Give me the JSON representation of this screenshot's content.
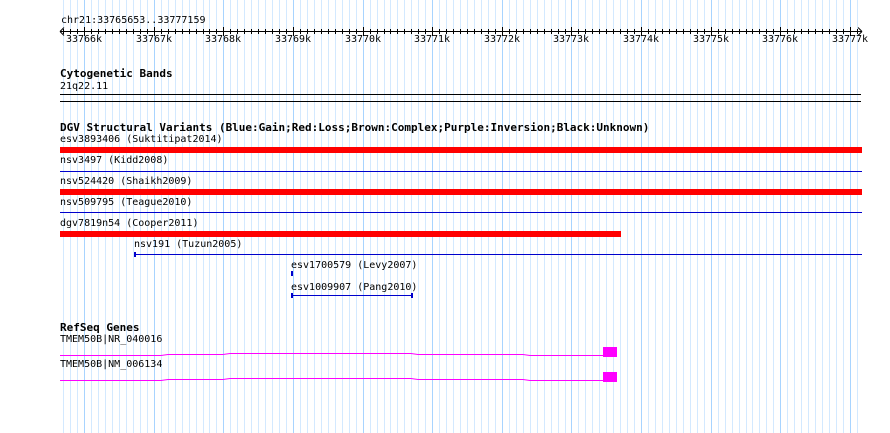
{
  "ruler": {
    "label": "chr21:33765653..33777159",
    "start": 33765653,
    "end": 33777159,
    "ticks": [
      "33766k",
      "33767k",
      "33768k",
      "33769k",
      "33770k",
      "33771k",
      "33772k",
      "33773k",
      "33774k",
      "33775k",
      "33776k",
      "33777k"
    ],
    "tick_values": [
      33766000,
      33767000,
      33768000,
      33769000,
      33770000,
      33771000,
      33772000,
      33773000,
      33774000,
      33775000,
      33776000,
      33777000
    ]
  },
  "cytoband": {
    "title": "Cytogenetic Bands",
    "band": "21q22.11"
  },
  "dgv": {
    "title": "DGV Structural Variants (Blue:Gain;Red:Loss;Brown:Complex;Purple:Inversion;Black:Unknown)",
    "variants": [
      {
        "label": "esv3893406 (Suktitipat2014)",
        "type": "Loss",
        "start": 33765653,
        "end": 33777159
      },
      {
        "label": "nsv3497 (Kidd2008)",
        "type": "Gain",
        "start": 33765653,
        "end": 33777159
      },
      {
        "label": "nsv524420 (Shaikh2009)",
        "type": "Loss",
        "start": 33765653,
        "end": 33777159
      },
      {
        "label": "nsv509795 (Teague2010)",
        "type": "Gain",
        "start": 33765653,
        "end": 33777159
      },
      {
        "label": "dgv7819n54 (Cooper2011)",
        "type": "Loss",
        "start": 33765653,
        "end": 33773700
      },
      {
        "label": "nsv191 (Tuzun2005)",
        "type": "Gain",
        "start": 33766720,
        "end": 33777159
      },
      {
        "label": "esv1700579 (Levy2007)",
        "type": "Gain",
        "start": 33768970,
        "end": 33768990
      },
      {
        "label": "esv1009907 (Pang2010)",
        "type": "Gain",
        "start": 33768970,
        "end": 33770710
      }
    ]
  },
  "refseq": {
    "title": "RefSeq Genes",
    "genes": [
      {
        "label": "TMEM50B|NR_040016",
        "start": 33765653,
        "end": 33773650,
        "exon_start": 33773450,
        "exon_end": 33773650
      },
      {
        "label": "TMEM50B|NM_006134",
        "start": 33765653,
        "end": 33773650,
        "exon_start": 33773450,
        "exon_end": 33773650
      }
    ]
  },
  "colors": {
    "gain": "#0000cc",
    "loss": "#ff0000",
    "gene": "#ff00ff",
    "grid_major": "#a8d4ff",
    "grid_minor": "#d3e9ff",
    "ruler": "#000000"
  }
}
